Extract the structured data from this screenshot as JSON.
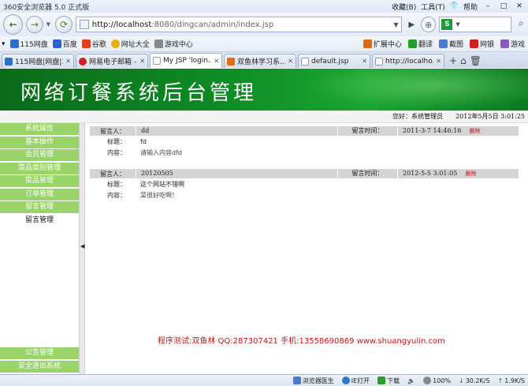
{
  "window": {
    "title": "360安全浏览器 5.0 正式版",
    "menu": [
      "收藏(B)",
      "工具(T)",
      "帮助"
    ]
  },
  "navbar": {
    "url_host": "http://localhost",
    "url_path": ":8080/dingcan/admin/index.jsp"
  },
  "favorites": {
    "left": [
      "115网盘",
      "百度",
      "谷歌",
      "网址大全",
      "游戏中心"
    ],
    "right": [
      "扩展中心",
      "翻译",
      "截图",
      "网银",
      "游戏"
    ]
  },
  "tabs": [
    {
      "label": "115网盘|网盘|1...",
      "active": false
    },
    {
      "label": "网易电子邮箱 -...",
      "active": false
    },
    {
      "label": "My JSP 'login...",
      "active": true
    },
    {
      "label": "双鱼林学习系...",
      "active": false
    },
    {
      "label": "default.jsp",
      "active": false
    },
    {
      "label": "http://localho...",
      "active": false
    }
  ],
  "banner": {
    "title": "网络订餐系统后台管理"
  },
  "infobar": {
    "greeting": "您好：系统管理员",
    "date": "2012年5月5日  3:01:25"
  },
  "sidebar": {
    "items": [
      {
        "label": "系统属性",
        "selected": false
      },
      {
        "label": "基本操作",
        "selected": false
      },
      {
        "label": "会员管理",
        "selected": false
      },
      {
        "label": "菜品类别管理",
        "selected": false
      },
      {
        "label": "菜品管理",
        "selected": false
      },
      {
        "label": "订单管理",
        "selected": false
      },
      {
        "label": "留言管理",
        "selected": false
      },
      {
        "label": "留言管理",
        "selected": true
      }
    ],
    "bottom_items": [
      "公告管理",
      "安全退出系统"
    ]
  },
  "messages": {
    "author_label": "留言人：",
    "time_label": "留言时间：",
    "title_label": "标题：",
    "content_label": "内容：",
    "delete_label": "删除",
    "items": [
      {
        "author": "dd",
        "time": "2011-3-7 14:46:16",
        "title": "fd",
        "content": "请输入内容dfd"
      },
      {
        "author": "20120505",
        "time": "2012-5-5 3:01:05",
        "title": "这个网站不错啊",
        "content": "菜很好吃啊！"
      }
    ]
  },
  "footer_note": "程序测试:双鱼林 QQ:287307421 手机:13558690869 www.shuangyulin.com",
  "statusbar": {
    "items": [
      "浏览器医生",
      "IE打开",
      "下载",
      "100%",
      "30.2K/S",
      "1.9K/S"
    ]
  },
  "colors": {
    "banner_green": "#0e8a24",
    "sidebar_green": "#98d468",
    "delete_red": "#d01010",
    "footer_red": "#c8141e"
  }
}
